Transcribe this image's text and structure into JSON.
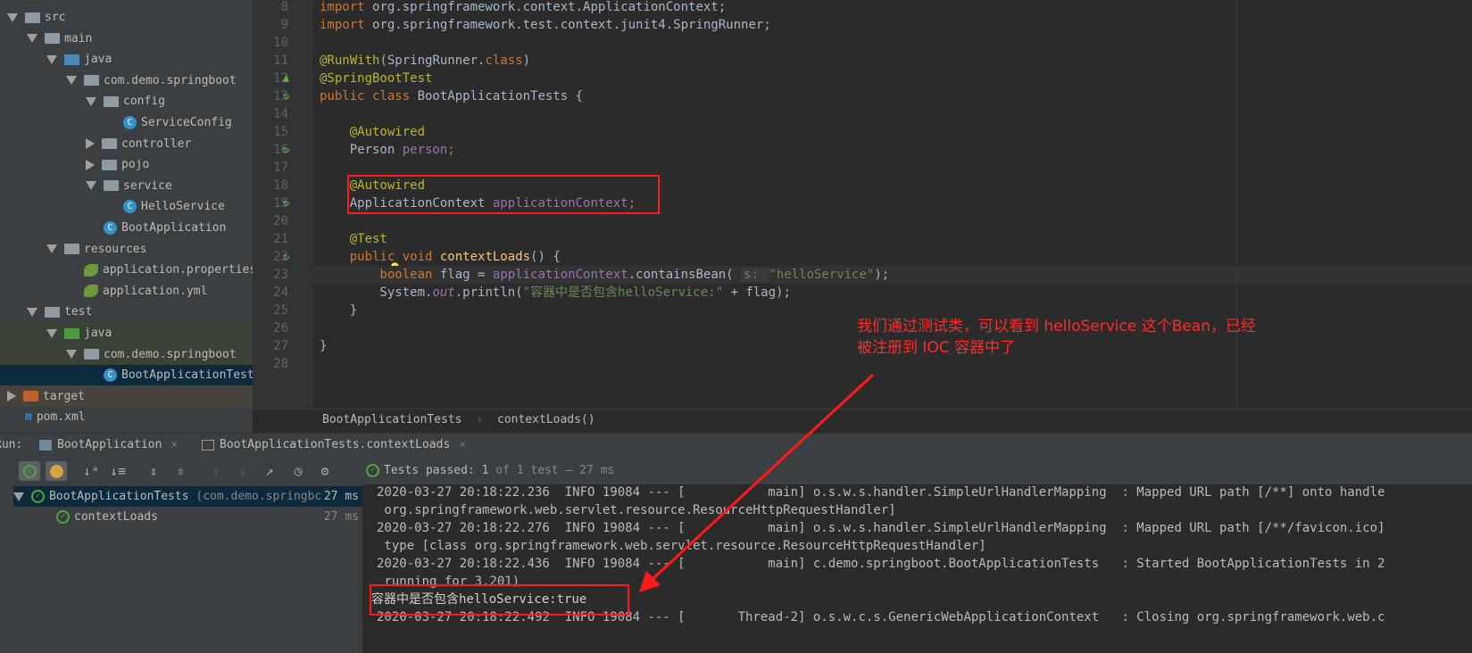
{
  "project_tree": [
    {
      "label": "src",
      "type": "folder",
      "depth": 0,
      "open": true
    },
    {
      "label": "main",
      "type": "folder",
      "depth": 1,
      "open": true
    },
    {
      "label": "java",
      "type": "src-folder",
      "depth": 2,
      "open": true
    },
    {
      "label": "com.demo.springboot",
      "type": "package",
      "depth": 3,
      "open": true
    },
    {
      "label": "config",
      "type": "package",
      "depth": 4,
      "open": true
    },
    {
      "label": "ServiceConfig",
      "type": "class",
      "depth": 5
    },
    {
      "label": "controller",
      "type": "package",
      "depth": 4,
      "open": false
    },
    {
      "label": "pojo",
      "type": "package",
      "depth": 4,
      "open": false
    },
    {
      "label": "service",
      "type": "package",
      "depth": 4,
      "open": true
    },
    {
      "label": "HelloService",
      "type": "class",
      "depth": 5
    },
    {
      "label": "BootApplication",
      "type": "class",
      "depth": 4
    },
    {
      "label": "resources",
      "type": "res-folder",
      "depth": 2,
      "open": true
    },
    {
      "label": "application.properties",
      "type": "spring",
      "depth": 3
    },
    {
      "label": "application.yml",
      "type": "spring",
      "depth": 3
    },
    {
      "label": "test",
      "type": "folder",
      "depth": 1,
      "open": true
    },
    {
      "label": "java",
      "type": "test-folder",
      "depth": 2,
      "open": true
    },
    {
      "label": "com.demo.springboot",
      "type": "package",
      "depth": 3,
      "open": true
    },
    {
      "label": "BootApplicationTests",
      "type": "class",
      "depth": 4,
      "selected": true
    },
    {
      "label": "target",
      "type": "target-folder",
      "depth": 0,
      "open": false
    },
    {
      "label": "pom.xml",
      "type": "maven",
      "depth": 0
    }
  ],
  "editor": {
    "line_numbers": [
      "8",
      "9",
      "10",
      "11",
      "12",
      "13",
      "14",
      "15",
      "16",
      "17",
      "18",
      "19",
      "20",
      "21",
      "22",
      "23",
      "24",
      "25",
      "26",
      "27",
      "28"
    ],
    "lines": [
      [
        {
          "t": "import ",
          "c": "kw"
        },
        {
          "t": "org.springframework.context.ApplicationContext;"
        }
      ],
      [
        {
          "t": "import ",
          "c": "kw"
        },
        {
          "t": "org.springframework.test.context.junit4.SpringRunner;"
        }
      ],
      [],
      [
        {
          "t": "@RunWith",
          "c": "an"
        },
        {
          "t": "(SpringRunner."
        },
        {
          "t": "class",
          "c": "kw"
        },
        {
          "t": ")"
        }
      ],
      [
        {
          "t": "@SpringBootTest",
          "c": "an"
        }
      ],
      [
        {
          "t": "public class ",
          "c": "kw"
        },
        {
          "t": "BootApplicationTests {"
        }
      ],
      [],
      [
        {
          "t": "    "
        },
        {
          "t": "@Autowired",
          "c": "an"
        }
      ],
      [
        {
          "t": "    Person "
        },
        {
          "t": "person",
          "c": "fd"
        },
        {
          "t": ";",
          "c": "kw"
        }
      ],
      [],
      [
        {
          "t": "    "
        },
        {
          "t": "@Autowired",
          "c": "an"
        }
      ],
      [
        {
          "t": "    ApplicationContext "
        },
        {
          "t": "applicationContext",
          "c": "fd"
        },
        {
          "t": ";",
          "c": "kw"
        }
      ],
      [],
      [
        {
          "t": "    "
        },
        {
          "t": "@Test",
          "c": "an"
        }
      ],
      [
        {
          "t": "    "
        },
        {
          "t": "public void ",
          "c": "kw"
        },
        {
          "t": "contextLoads",
          "c": "fn"
        },
        {
          "t": "() {"
        }
      ],
      [
        {
          "t": "        "
        },
        {
          "t": "boolean ",
          "c": "kw"
        },
        {
          "t": "flag = "
        },
        {
          "t": "applicationContext",
          "c": "fd"
        },
        {
          "t": ".containsBean( "
        },
        {
          "t": "s: ",
          "c": "hint"
        },
        {
          "t": "\"helloService\"",
          "c": "st"
        },
        {
          "t": ");"
        }
      ],
      [
        {
          "t": "        System."
        },
        {
          "t": "out",
          "c": "it"
        },
        {
          "t": ".println("
        },
        {
          "t": "\"容器中是否包含helloService:\"",
          "c": "st"
        },
        {
          "t": " + flag);"
        }
      ],
      [
        {
          "t": "    }"
        }
      ],
      [],
      [
        {
          "t": "}"
        }
      ],
      []
    ]
  },
  "breadcrumb": [
    "BootApplicationTests",
    "contextLoads()"
  ],
  "run_panel": {
    "label": "Run:",
    "tabs": [
      {
        "label": "BootApplication",
        "active": false
      },
      {
        "label": "BootApplicationTests.contextLoads",
        "active": true
      }
    ],
    "status": {
      "prefix": "Tests passed: ",
      "count": "1",
      "of": " of 1 test – 27 ms"
    },
    "test_tree": [
      {
        "label": "BootApplicationTests",
        "detail": " (com.demo.springbc",
        "time": "27 ms",
        "selected": true
      },
      {
        "label": "contextLoads",
        "detail": "",
        "time": "27 ms",
        "selected": false
      }
    ],
    "console": [
      "2020-03-27 20:18:22.236  INFO 19084 --- [           main] o.s.w.s.handler.SimpleUrlHandlerMapping  : Mapped URL path [/**] onto handle",
      " org.springframework.web.servlet.resource.ResourceHttpRequestHandler]",
      "2020-03-27 20:18:22.276  INFO 19084 --- [           main] o.s.w.s.handler.SimpleUrlHandlerMapping  : Mapped URL path [/**/favicon.ico]",
      " type [class org.springframework.web.servlet.resource.ResourceHttpRequestHandler]",
      "2020-03-27 20:18:22.436  INFO 19084 --- [           main] c.demo.springboot.BootApplicationTests   : Started BootApplicationTests in 2",
      " running for 3.201)",
      "容器中是否包含helloService:true",
      "2020-03-27 20:18:22.492  INFO 19084 --- [       Thread-2] o.s.w.c.s.GenericWebApplicationContext   : Closing org.springframework.web.c"
    ]
  },
  "annotation": {
    "text": "我们通过测试类，可以看到 helloService 这个Bean，已经\n被注册到 IOC 容器中了",
    "color": "#ff2a2a"
  }
}
